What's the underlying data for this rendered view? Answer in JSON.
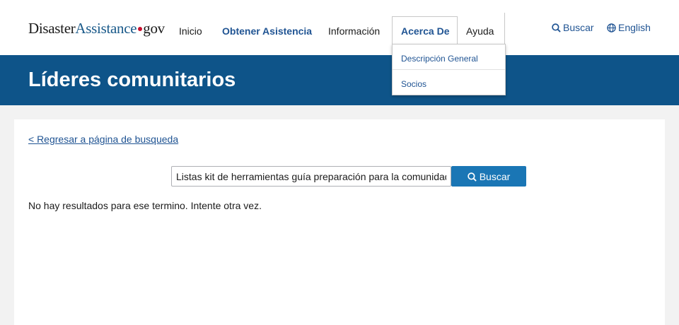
{
  "logo": {
    "part1": "Disaster",
    "part2": "Assistance",
    "part3": "gov"
  },
  "nav": {
    "items": [
      {
        "label": "Inicio"
      },
      {
        "label": "Obtener Asistencia"
      },
      {
        "label": "Información"
      },
      {
        "label": "Acerca De"
      },
      {
        "label": "Ayuda"
      }
    ],
    "dropdown": [
      {
        "label": "Descripción General"
      },
      {
        "label": "Socios"
      }
    ]
  },
  "utility": {
    "search_label": "Buscar",
    "language_label": "English"
  },
  "hero": {
    "title": "Líderes comunitarios"
  },
  "main": {
    "back_link": "< Regresar a página de busqueda",
    "search": {
      "value": "Listas kit de herramientas guía preparación para la comunidad",
      "button_label": "Buscar"
    },
    "no_results": "No hay resultados para ese termino. Intente otra vez."
  },
  "colors": {
    "hero": "#0e5489",
    "link": "#205493",
    "button": "#1a76b5",
    "logo_dot": "#c8102e"
  }
}
